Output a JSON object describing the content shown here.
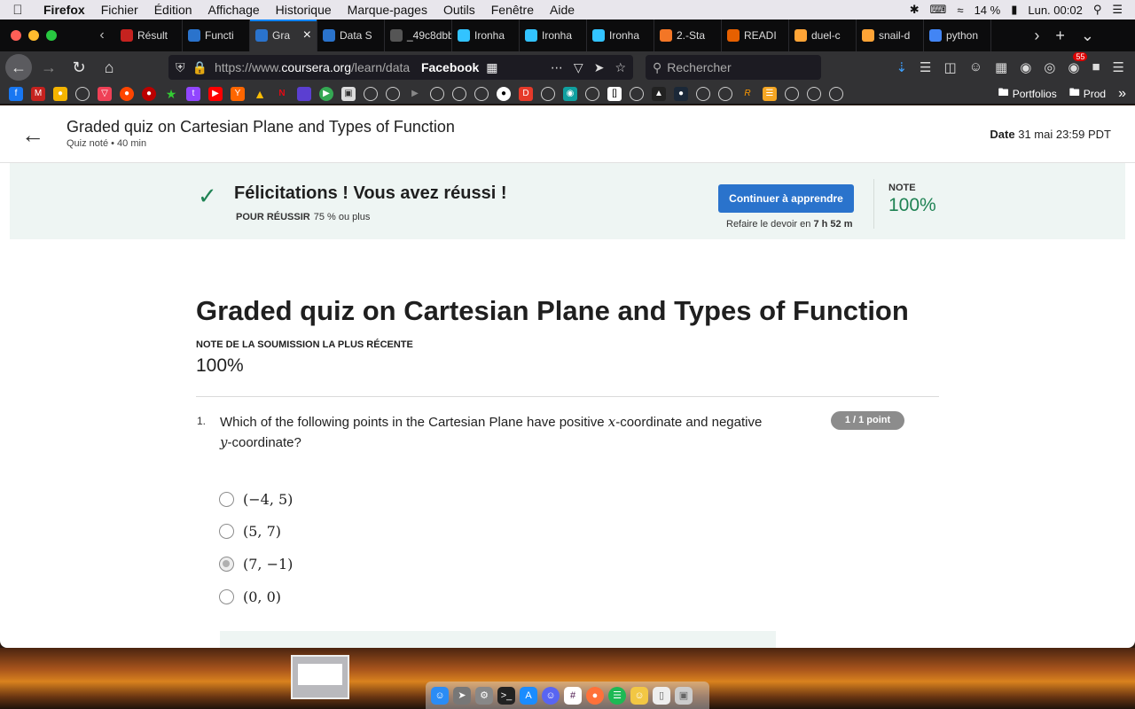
{
  "menubar": {
    "app": "Firefox",
    "items": [
      "Fichier",
      "Édition",
      "Affichage",
      "Historique",
      "Marque-pages",
      "Outils",
      "Fenêtre",
      "Aide"
    ],
    "battery": "14 %",
    "clock": "Lun. 00:02"
  },
  "tabs": [
    {
      "label": "Résult",
      "icon": "gmail-icon",
      "color": "#c5221f"
    },
    {
      "label": "Functi",
      "icon": "coursera-icon",
      "color": "#2a73cc"
    },
    {
      "label": "Gra",
      "icon": "coursera-icon",
      "color": "#2a73cc"
    },
    {
      "label": "Data S",
      "icon": "coursera-icon",
      "color": "#2a73cc"
    },
    {
      "label": "_49c8dbbf",
      "icon": "blank-icon",
      "color": "#555555"
    },
    {
      "label": "Ironha",
      "icon": "ironhack-icon",
      "color": "#32c3ff"
    },
    {
      "label": "Ironha",
      "icon": "ironhack-icon",
      "color": "#32c3ff"
    },
    {
      "label": "Ironha",
      "icon": "ironhack-icon",
      "color": "#32c3ff"
    },
    {
      "label": "2.-Sta",
      "icon": "jupyter-icon",
      "color": "#f37626"
    },
    {
      "label": "READI",
      "icon": "document-icon",
      "color": "#e66000"
    },
    {
      "label": "duel-c",
      "icon": "doc-icon",
      "color": "#ffa436"
    },
    {
      "label": "snail-d",
      "icon": "doc-icon",
      "color": "#ffa436"
    },
    {
      "label": "python",
      "icon": "google-icon",
      "color": "#4285f4"
    }
  ],
  "navbar": {
    "url_prefix": "https://www.",
    "url_domain": "coursera.org",
    "url_suffix": "/learn/data",
    "site_label": "Facebook",
    "search_placeholder": "Rechercher",
    "badge_count": "55"
  },
  "bookmarks": {
    "folders": [
      "Portfolios",
      "Prod"
    ]
  },
  "header": {
    "title": "Graded quiz on Cartesian Plane and Types of Function",
    "subtitle": "Quiz noté • 40  min",
    "date_label": "Date",
    "date_value": "31 mai 23:59 PDT"
  },
  "banner": {
    "congrats": "Félicitations ! Vous avez réussi !",
    "pass_label": "POUR RÉUSSIR",
    "pass_value": "75 % ou plus",
    "continue_label": "Continuer à apprendre",
    "retry_text": "Refaire le devoir en",
    "retry_time": "7 h 52 m",
    "note_label": "NOTE",
    "note_value": "100%"
  },
  "main": {
    "title": "Graded quiz on Cartesian Plane and Types of Function",
    "recent_label": "NOTE DE LA SOUMISSION LA PLUS RÉCENTE",
    "recent_value": "100%"
  },
  "question": {
    "number": "1.",
    "text_a": "Which of the following points in the Cartesian Plane have positive ",
    "var_x": "x",
    "text_b": "-coordinate and negative ",
    "var_y": "y",
    "text_c": "-coordinate?",
    "points": "1 / 1 point",
    "options": [
      "(−4, 5)",
      "(5, 7)",
      "(7, −1)",
      "(0, 0)"
    ],
    "selected_index": 2
  },
  "colors": {
    "accent": "#2a73cc",
    "success": "#1f8354",
    "banner_bg": "#eef5f3"
  }
}
